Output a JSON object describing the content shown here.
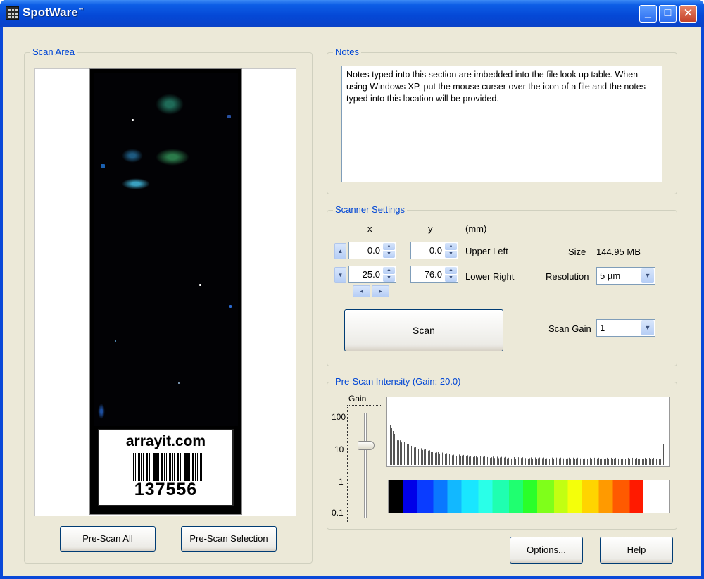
{
  "window": {
    "title": "SpotWare",
    "title_mark": "™",
    "minimize": "_",
    "maximize": "□",
    "close": "✕"
  },
  "scan_area": {
    "title": "Scan Area",
    "slide_label": {
      "brand": "arrayit.com",
      "number": "137556"
    },
    "prescan_all": "Pre-Scan All",
    "prescan_selection": "Pre-Scan Selection"
  },
  "notes": {
    "title": "Notes",
    "text": "Notes typed into this section are imbedded into the file look up table. When using Windows XP, put the mouse curser over the icon of a file and the notes typed into this location will be provided."
  },
  "scanner_settings": {
    "title": "Scanner Settings",
    "col_x": "x",
    "col_y": "y",
    "unit": "(mm)",
    "upper_left_label": "Upper Left",
    "lower_right_label": "Lower Right",
    "upper_left_x": "0.0",
    "upper_left_y": "0.0",
    "lower_right_x": "25.0",
    "lower_right_y": "76.0",
    "size_label": "Size",
    "size_value": "144.95 MB",
    "resolution_label": "Resolution",
    "resolution_value": "5 µm",
    "scan_gain_label": "Scan Gain",
    "scan_gain_value": "1",
    "scan_button": "Scan"
  },
  "prescan_intensity": {
    "title": "Pre-Scan Intensity (Gain: 20.0)",
    "gain_label": "Gain",
    "ticks": [
      "100",
      "10",
      "1",
      "0.1"
    ],
    "slider_value": 20.0
  },
  "footer": {
    "options": "Options...",
    "help": "Help"
  },
  "icons": {
    "app": "spotware-app-icon",
    "spin_up": "▲",
    "spin_down": "▼",
    "nudge_up": "▲",
    "nudge_down": "▼",
    "nudge_left": "◄",
    "nudge_right": "►",
    "dropdown": "▼"
  }
}
